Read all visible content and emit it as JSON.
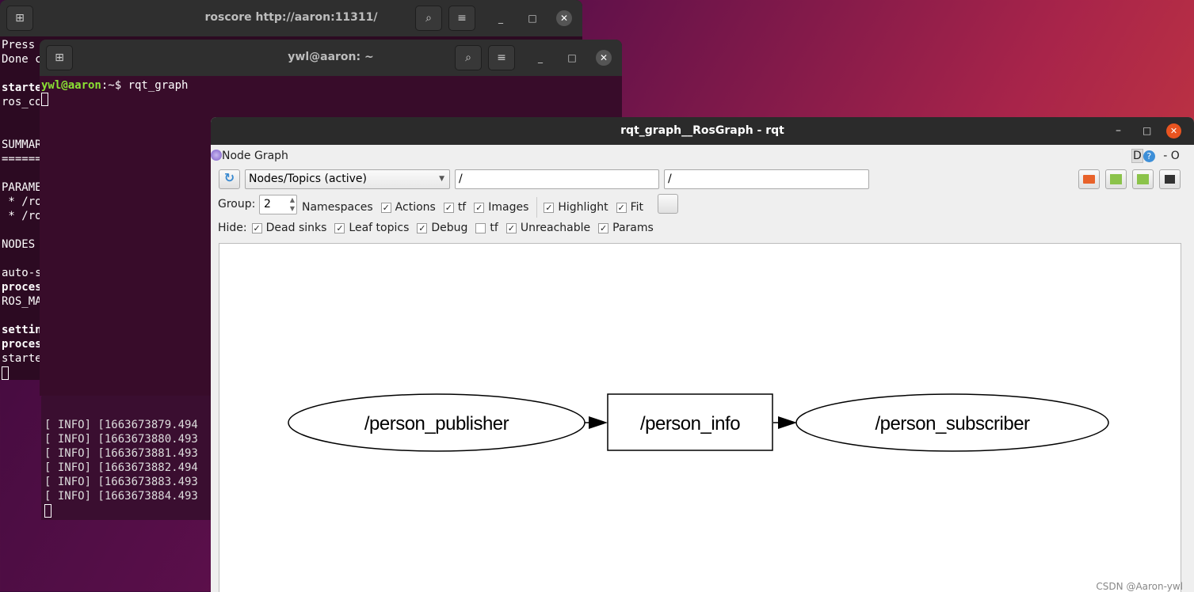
{
  "terminal_roscore": {
    "title": "roscore http://aaron:11311/",
    "lines": [
      "Press",
      "Done c",
      "",
      "starte",
      "ros_co",
      "",
      "",
      "SUMMAR",
      "======",
      "",
      "PARAME",
      " * /ro",
      " * /ro",
      "",
      "NODES",
      "",
      "auto-s",
      "proces",
      "ROS_MA",
      "",
      "settin",
      "proces",
      "starte"
    ]
  },
  "terminal_main": {
    "title": "ywl@aaron: ~",
    "prompt_user": "ywl@aaron",
    "prompt_path": ":~$ ",
    "command": "rqt_graph"
  },
  "terminal_log": {
    "lines": [
      "[ INFO] [1663673879.494",
      "[ INFO] [1663673880.493",
      "[ INFO] [1663673881.493",
      "[ INFO] [1663673882.494",
      "[ INFO] [1663673883.493",
      "[ INFO] [1663673884.493"
    ]
  },
  "rqt": {
    "title": "rqt_graph__RosGraph - rqt",
    "plugin_title": "Node Graph",
    "corner_d": "D",
    "corner_help": "?",
    "corner_dash": "- O",
    "mode_select": "Nodes/Topics (active)",
    "filter1": "/",
    "filter2": "/",
    "group_label": "Group:",
    "group_value": "2",
    "row1": [
      {
        "label": "Namespaces",
        "checked": null
      },
      {
        "label": "Actions",
        "checked": true
      },
      {
        "label": "tf",
        "checked": true
      },
      {
        "label": "Images",
        "checked": true
      },
      {
        "label": "Highlight",
        "checked": true
      },
      {
        "label": "Fit",
        "checked": true
      }
    ],
    "hide_label": "Hide:",
    "hide": [
      {
        "label": "Dead sinks",
        "checked": true
      },
      {
        "label": "Leaf topics",
        "checked": true
      },
      {
        "label": "Debug",
        "checked": true
      },
      {
        "label": "tf",
        "checked": false
      },
      {
        "label": "Unreachable",
        "checked": true
      },
      {
        "label": "Params",
        "checked": true
      }
    ],
    "graph": {
      "nodes": [
        "/person_publisher",
        "/person_info",
        "/person_subscriber"
      ]
    },
    "watermark": "CSDN @Aaron-ywl"
  },
  "check_glyph": "✓"
}
